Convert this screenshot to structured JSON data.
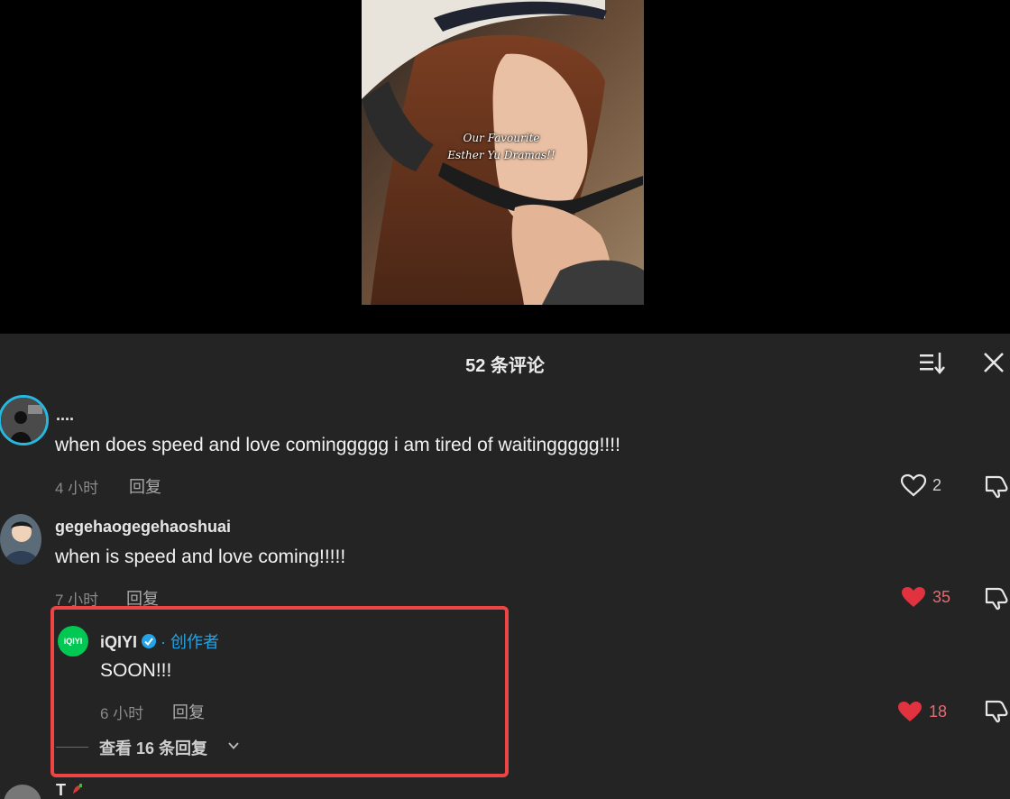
{
  "video": {
    "caption_line1": "Our Favourite",
    "caption_line2": "Esther Yu Dramas!!"
  },
  "panel": {
    "title": "52 条评论",
    "sort_icon": "sort-list-icon",
    "close_icon": "close-icon"
  },
  "comments": [
    {
      "username": "....",
      "text": "when does speed and love cominggggg i am tired of waitinggggg!!!!",
      "time": "4 小时",
      "reply_label": "回复",
      "likes": "2",
      "liked": false
    },
    {
      "username": "gegehaogegehaoshuai",
      "text": "when is speed and love coming!!!!!",
      "time": "7 小时",
      "reply_label": "回复",
      "likes": "35",
      "liked": true
    }
  ],
  "reply": {
    "username": "iQIYI",
    "separator": "·",
    "creator_label": "创作者",
    "avatar_text": "iQIYI",
    "text": "SOON!!!",
    "time": "6 小时",
    "reply_label": "回复",
    "likes": "18",
    "liked": true,
    "view_replies": "查看 16 条回复"
  },
  "next_comment": {
    "username": "T"
  },
  "colors": {
    "panel_bg": "#242424",
    "liked_heart": "#e0323f",
    "creator_blue": "#22a4e6",
    "highlight_red": "#ef4444",
    "iqiyi_green": "#00c853"
  }
}
